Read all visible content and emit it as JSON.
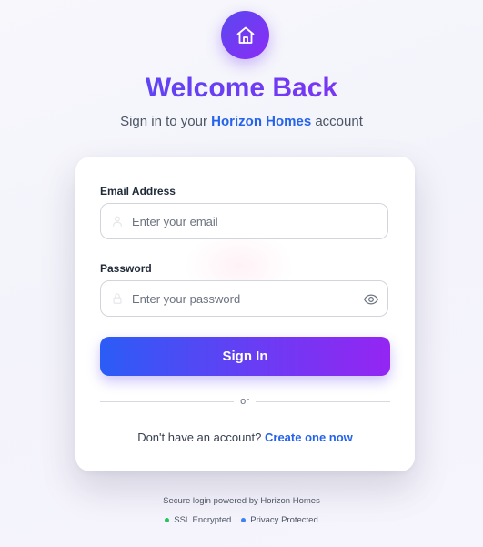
{
  "header": {
    "logo_icon": "house-icon",
    "title": "Welcome Back",
    "subtitle_prefix": "Sign in to your ",
    "subtitle_brand": "Horizon Homes",
    "subtitle_suffix": " account"
  },
  "form": {
    "email": {
      "label": "Email Address",
      "placeholder": "Enter your email",
      "value": "",
      "icon": "user-icon"
    },
    "password": {
      "label": "Password",
      "placeholder": "Enter your password",
      "value": "",
      "icon": "lock-icon",
      "toggle_icon": "eye-icon"
    },
    "submit_label": "Sign In",
    "divider_text": "or",
    "signup_prompt": "Don't have an account? ",
    "signup_link": "Create one now"
  },
  "footer": {
    "text": "Secure login powered by Horizon Homes",
    "badges": [
      {
        "label": "SSL Encrypted",
        "color": "#22c55e"
      },
      {
        "label": "Privacy Protected",
        "color": "#3b82f6"
      }
    ]
  },
  "colors": {
    "accent_start": "#4f4ef5",
    "accent_end": "#8a2cf3",
    "link": "#2563eb"
  }
}
